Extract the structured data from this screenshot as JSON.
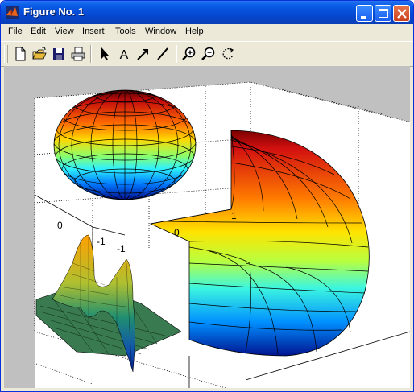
{
  "window": {
    "title": "Figure No. 1"
  },
  "menu": {
    "items": [
      {
        "id": "file",
        "label": "File",
        "accel": "F"
      },
      {
        "id": "edit",
        "label": "Edit",
        "accel": "E"
      },
      {
        "id": "view",
        "label": "View",
        "accel": "V"
      },
      {
        "id": "insert",
        "label": "Insert",
        "accel": "I"
      },
      {
        "id": "tools",
        "label": "Tools",
        "accel": "T"
      },
      {
        "id": "window",
        "label": "Window",
        "accel": "W"
      },
      {
        "id": "help",
        "label": "Help",
        "accel": "H"
      }
    ]
  },
  "toolbar": {
    "icons": [
      "new-file-icon",
      "open-folder-icon",
      "save-icon",
      "print-icon",
      "select-arrow-icon",
      "insert-text-icon",
      "insert-arrow-icon",
      "insert-line-icon",
      "zoom-in-icon",
      "zoom-out-icon",
      "rotate-3d-icon"
    ],
    "text_tool_glyph": "A"
  },
  "plot": {
    "tick_labels": {
      "zero_left": "0",
      "zero_mid": "0",
      "neg_one_a": "-1",
      "neg_one_b": "-1",
      "one": "1"
    }
  },
  "colors": {
    "titlebar": "#0a5ee8",
    "figure_bg": "#c0c0c0",
    "axes_bg": "#ffffff"
  }
}
